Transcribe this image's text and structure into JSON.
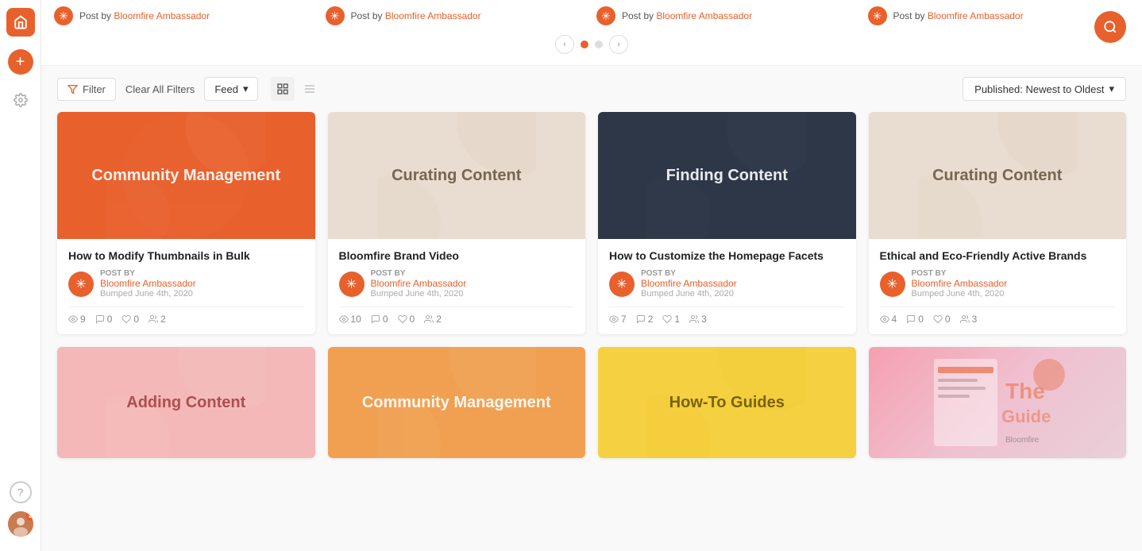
{
  "sidebar": {
    "home_label": "Home",
    "add_label": "Add",
    "settings_label": "Settings",
    "help_label": "Help",
    "avatar_badge": "2"
  },
  "carousel": {
    "posts": [
      {
        "label": "Post by",
        "author": "Bloomfire Ambassador"
      },
      {
        "label": "Post by",
        "author": "Bloomfire Ambassador"
      },
      {
        "label": "Post by",
        "author": "Bloomfire Ambassador"
      },
      {
        "label": "Post by",
        "author": "Bloomfire Ambassador"
      }
    ],
    "dots": [
      "active",
      "inactive"
    ],
    "prev_label": "‹",
    "next_label": "›"
  },
  "filter_bar": {
    "filter_label": "Filter",
    "clear_label": "Clear All Filters",
    "feed_label": "Feed",
    "sort_label": "Published: Newest to Oldest"
  },
  "cards": [
    {
      "id": "card-1",
      "theme": "theme-orange",
      "thumb_text": "Community Management",
      "title": "How to Modify Thumbnails in Bulk",
      "post_by": "POST BY",
      "author": "Bloomfire Ambassador",
      "date": "Bumped June 4th, 2020",
      "stats": {
        "views": "9",
        "comments": "0",
        "likes": "0",
        "contributors": "2"
      }
    },
    {
      "id": "card-2",
      "theme": "theme-cream",
      "thumb_text": "Curating Content",
      "title": "Bloomfire Brand Video",
      "post_by": "POST BY",
      "author": "Bloomfire Ambassador",
      "date": "Bumped June 4th, 2020",
      "stats": {
        "views": "10",
        "comments": "0",
        "likes": "0",
        "contributors": "2"
      }
    },
    {
      "id": "card-3",
      "theme": "theme-dark",
      "thumb_text": "Finding Content",
      "title": "How to Customize the Homepage Facets",
      "post_by": "POST BY",
      "author": "Bloomfire Ambassador",
      "date": "Bumped June 4th, 2020",
      "stats": {
        "views": "7",
        "comments": "2",
        "likes": "1",
        "contributors": "3"
      }
    },
    {
      "id": "card-4",
      "theme": "theme-light-cream",
      "thumb_text": "Curating Content",
      "title": "Ethical and Eco-Friendly Active Brands",
      "post_by": "POST BY",
      "author": "Bloomfire Ambassador",
      "date": "Bumped June 4th, 2020",
      "stats": {
        "views": "4",
        "comments": "0",
        "likes": "0",
        "contributors": "3"
      }
    },
    {
      "id": "card-5",
      "theme": "theme-pink",
      "thumb_text": "Adding Content",
      "title": "",
      "post_by": "",
      "author": "",
      "date": "",
      "stats": {
        "views": "",
        "comments": "",
        "likes": "",
        "contributors": ""
      }
    },
    {
      "id": "card-6",
      "theme": "theme-orange2",
      "thumb_text": "Community Management",
      "title": "",
      "post_by": "",
      "author": "",
      "date": "",
      "stats": {
        "views": "",
        "comments": "",
        "likes": "",
        "contributors": ""
      }
    },
    {
      "id": "card-7",
      "theme": "theme-yellow",
      "thumb_text": "How-To Guides",
      "title": "",
      "post_by": "",
      "author": "",
      "date": "",
      "stats": {
        "views": "",
        "comments": "",
        "likes": "",
        "contributors": ""
      }
    },
    {
      "id": "card-8",
      "theme": "theme-photo",
      "thumb_text": "",
      "title": "",
      "post_by": "",
      "author": "",
      "date": "",
      "stats": {
        "views": "",
        "comments": "",
        "likes": "",
        "contributors": ""
      }
    }
  ],
  "icons": {
    "home": "⌂",
    "add": "+",
    "settings": "⚙",
    "help": "?",
    "search": "🔍",
    "filter": "⧉",
    "chevron_down": "▾",
    "grid": "⊞",
    "list": "≡",
    "eye": "👁",
    "comment": "💬",
    "heart": "♡",
    "person": "👤",
    "prev": "‹",
    "next": "›",
    "star": "✳"
  }
}
